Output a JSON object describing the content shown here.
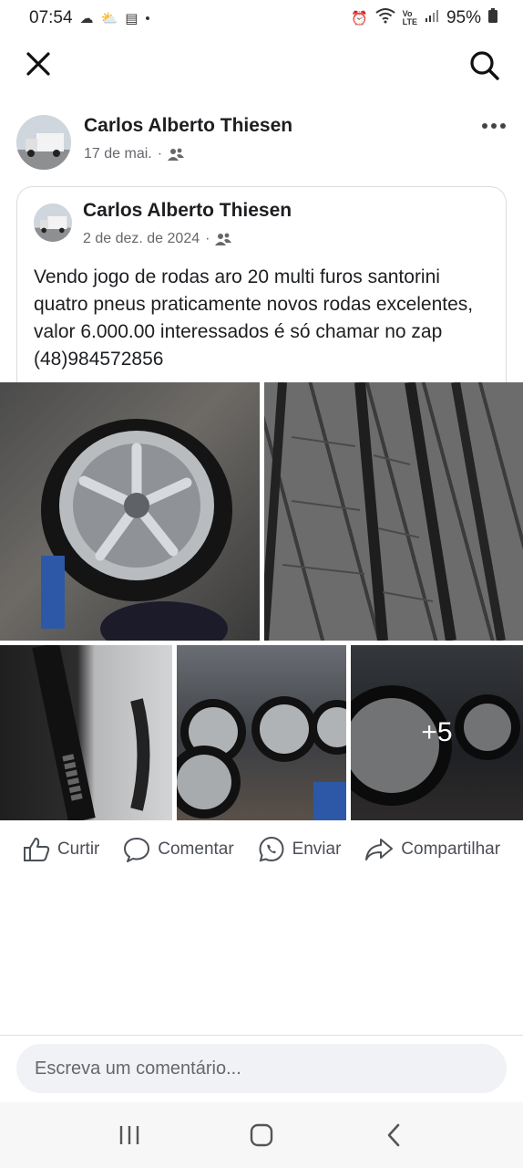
{
  "status_bar": {
    "time": "07:54",
    "battery": "95%",
    "icons_left": [
      "cloud-icon",
      "weather-icon",
      "calendar-icon",
      "dot-icon"
    ],
    "icons_right": [
      "alarm-icon",
      "wifi-icon",
      "volte-icon",
      "signal-icon",
      "battery-icon"
    ]
  },
  "top_bar": {
    "close_icon": "close-icon",
    "search_icon": "search-icon"
  },
  "post": {
    "author": "Carlos Alberto Thiesen",
    "date": "17 de mai.",
    "audience_icon": "friends-icon",
    "more_icon": "more-options-icon"
  },
  "shared_post": {
    "author": "Carlos Alberto Thiesen",
    "date": "2 de dez. de 2024",
    "audience_icon": "friends-icon",
    "text": "Vendo jogo de rodas aro 20 multi furos santorini quatro pneus praticamente novos rodas excelentes, valor 6.000.00 interessados é só chamar no zap (48)984572856",
    "photos_more": "+5"
  },
  "actions": {
    "like": "Curtir",
    "comment": "Comentar",
    "send": "Enviar",
    "share": "Compartilhar"
  },
  "comment_box": {
    "placeholder": "Escreva um comentário..."
  },
  "nav_bar": {
    "recents_icon": "recents-icon",
    "home_icon": "home-icon",
    "back_icon": "back-icon"
  }
}
